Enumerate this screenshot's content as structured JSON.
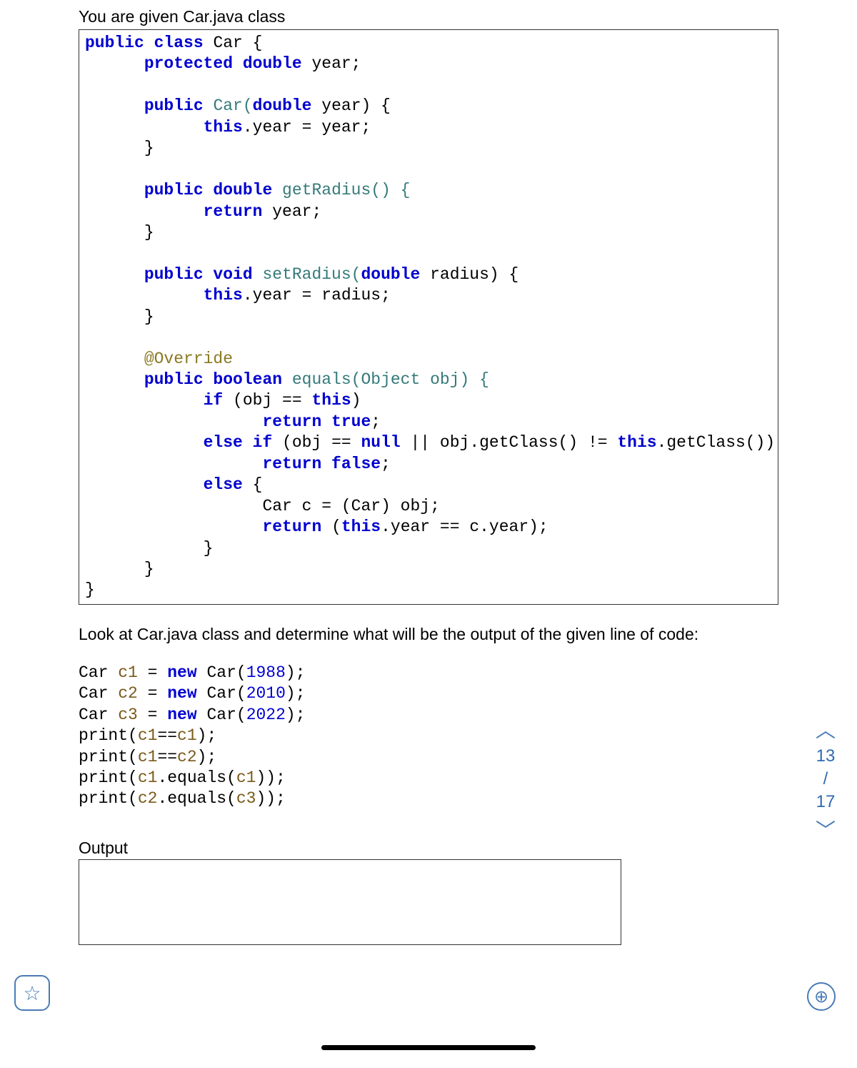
{
  "intro": "You are given Car.java class",
  "code": {
    "l1a": "public class",
    "l1b": " Car {",
    "l2a": "      protected double",
    "l2b": " year;",
    "l3": "",
    "l4a": "      public",
    "l4b": " Car(",
    "l4c": "double",
    "l4d": " year) {",
    "l5a": "            this",
    "l5b": ".year = year;",
    "l6": "      }",
    "l7": "",
    "l8a": "      public double",
    "l8b": " getRadius() {",
    "l9a": "            return",
    "l9b": " year;",
    "l10": "      }",
    "l11": "",
    "l12a": "      public void",
    "l12b": " setRadius(",
    "l12c": "double",
    "l12d": " radius) {",
    "l13a": "            this",
    "l13b": ".year = radius;",
    "l14": "      }",
    "l15": "",
    "l16": "      @Override",
    "l17a": "      public boolean",
    "l17b": " equals(Object obj) {",
    "l18a": "            if",
    "l18b": " (obj == ",
    "l18c": "this",
    "l18d": ")",
    "l19a": "                  return true",
    "l19b": ";",
    "l20a": "            else if",
    "l20b": " (obj == ",
    "l20c": "null",
    "l20d": " || obj.getClass() != ",
    "l20e": "this",
    "l20f": ".getClass())",
    "l21a": "                  return false",
    "l21b": ";",
    "l22a": "            else",
    "l22b": " {",
    "l23": "                  Car c = (Car) obj;",
    "l24a": "                  return",
    "l24b": " (",
    "l24c": "this",
    "l24d": ".year == c.year);",
    "l25": "            }",
    "l26": "      }",
    "l27": "}"
  },
  "question": "Look at Car.java class and determine what will be the output of the given line of code:",
  "code2": {
    "l1a": "Car ",
    "l1b": "c1",
    "l1c": " = ",
    "l1d": "new",
    "l1e": " Car(",
    "l1f": "1988",
    "l1g": ");",
    "l2a": "Car ",
    "l2b": "c2",
    "l2c": " = ",
    "l2d": "new",
    "l2e": " Car(",
    "l2f": "2010",
    "l2g": ");",
    "l3a": "Car ",
    "l3b": "c3",
    "l3c": " = ",
    "l3d": "new",
    "l3e": " Car(",
    "l3f": "2022",
    "l3g": ");",
    "l4a": "print(",
    "l4b": "c1",
    "l4c": "==",
    "l4d": "c1",
    "l4e": ");",
    "l5a": "print(",
    "l5b": "c1",
    "l5c": "==",
    "l5d": "c2",
    "l5e": ");",
    "l6a": "print(",
    "l6b": "c1",
    "l6c": ".equals(",
    "l6d": "c1",
    "l6e": "));",
    "l7a": "print(",
    "l7b": "c2",
    "l7c": ".equals(",
    "l7d": "c3",
    "l7e": "));"
  },
  "outputLabel": "Output",
  "nav": {
    "up": "︿",
    "current": "13",
    "slash": "/",
    "total": "17",
    "down": "﹀"
  },
  "zoomLabel": "⊕",
  "starLabel": "☆"
}
